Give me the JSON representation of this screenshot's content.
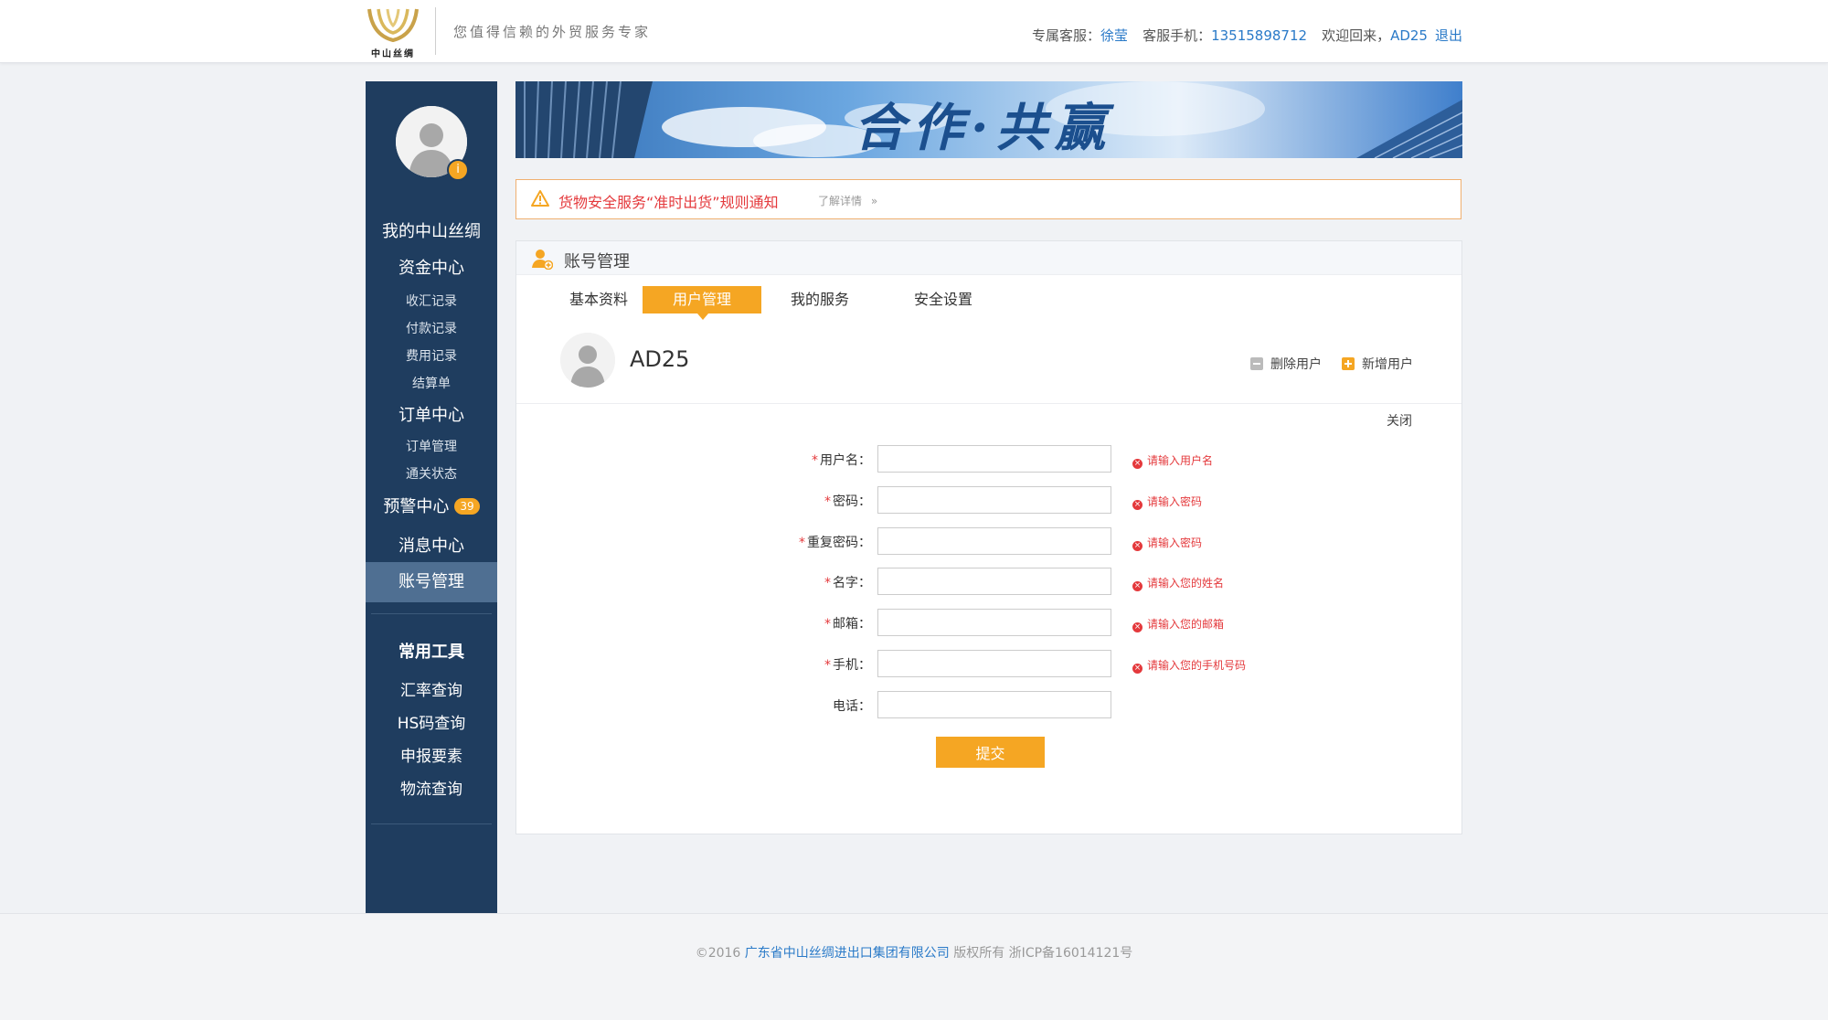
{
  "header": {
    "logo_text": "中山丝绸",
    "slogan": "您值得信赖的外贸服务专家",
    "service_label": "专属客服：",
    "service_name": "徐莹",
    "phone_label": "客服手机：",
    "phone": "13515898712",
    "welcome": "欢迎回来，",
    "username": "AD25",
    "logout": "退出"
  },
  "sidebar": {
    "my_home": "我的中山丝绸",
    "finance": {
      "title": "资金中心",
      "items": [
        "收汇记录",
        "付款记录",
        "费用记录",
        "结算单"
      ]
    },
    "orders": {
      "title": "订单中心",
      "items": [
        "订单管理",
        "通关状态"
      ]
    },
    "alerts": {
      "title": "预警中心",
      "badge": "39"
    },
    "messages": "消息中心",
    "account": "账号管理",
    "tools": {
      "title": "常用工具",
      "items": [
        "汇率查询",
        "HS码查询",
        "申报要素",
        "物流查询"
      ]
    },
    "avatar_badge": "i"
  },
  "banner": {
    "text": "合作·共赢"
  },
  "notice": {
    "text": "货物安全服务“准时出货”规则通知",
    "link": "了解详情",
    "link_arrow": "»"
  },
  "panel": {
    "title": "账号管理",
    "tabs": [
      "基本资料",
      "用户管理",
      "我的服务",
      "安全设置"
    ],
    "active_tab": "用户管理",
    "user_name": "AD25",
    "delete_user": "删除用户",
    "add_user": "新增用户",
    "close": "关闭",
    "form": {
      "fields": [
        {
          "label": "用户名：",
          "required": true,
          "error": "请输入用户名",
          "value": ""
        },
        {
          "label": "密码：",
          "required": true,
          "error": "请输入密码",
          "value": ""
        },
        {
          "label": "重复密码：",
          "required": true,
          "error": "请输入密码",
          "value": ""
        },
        {
          "label": "名字：",
          "required": true,
          "error": "请输入您的姓名",
          "value": ""
        },
        {
          "label": "邮箱：",
          "required": true,
          "error": "请输入您的邮箱",
          "value": ""
        },
        {
          "label": "手机：",
          "required": true,
          "error": "请输入您的手机号码",
          "value": ""
        },
        {
          "label": "电话：",
          "required": false,
          "error": "",
          "value": ""
        }
      ],
      "required_mark": "*",
      "error_icon": "×",
      "submit": "提交"
    }
  },
  "footer": {
    "prefix": "©2016",
    "company": "广东省中山丝绸进出口集团有限公司",
    "suffix": "版权所有 浙ICP备16014121号"
  },
  "colors": {
    "sidebar_bg": "#1f3d5f",
    "accent_orange": "#f5a623",
    "link_blue": "#2a7ac8",
    "error_red": "#e4393c"
  },
  "icons": [
    "logo-icon",
    "avatar-icon",
    "warning-icon",
    "account-user-icon",
    "minus-square-icon",
    "plus-square-icon",
    "error-x-icon"
  ]
}
